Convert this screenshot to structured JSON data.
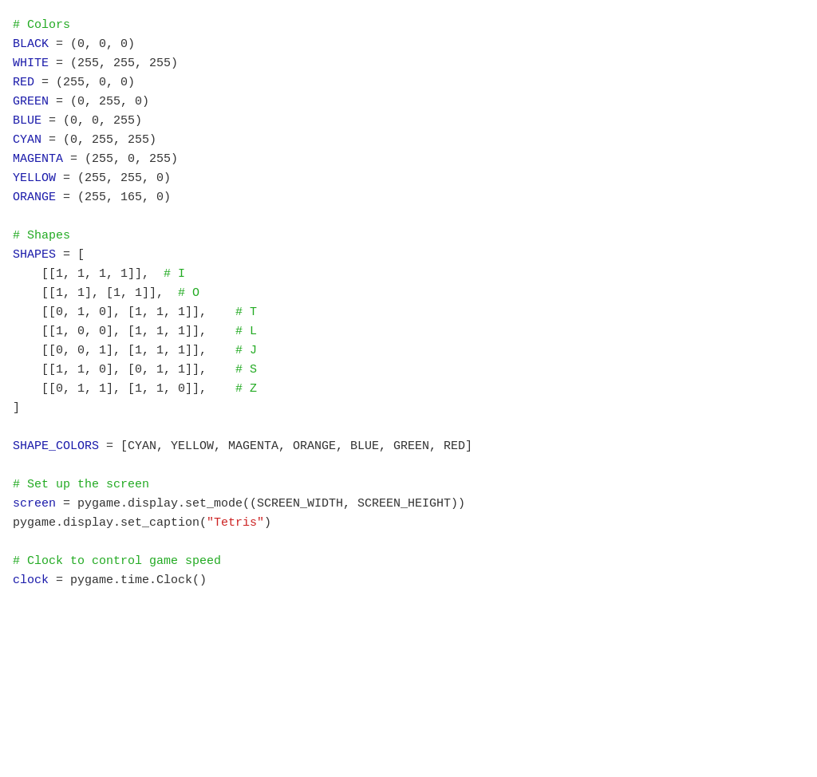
{
  "code": {
    "sections": [
      {
        "id": "colors-comment",
        "type": "comment",
        "text": "# Colors"
      },
      {
        "id": "black",
        "parts": [
          {
            "type": "variable",
            "text": "BLACK"
          },
          {
            "type": "plain",
            "text": " = (0, 0, 0)"
          }
        ]
      },
      {
        "id": "white",
        "parts": [
          {
            "type": "variable",
            "text": "WHITE"
          },
          {
            "type": "plain",
            "text": " = (255, 255, 255)"
          }
        ]
      },
      {
        "id": "red",
        "parts": [
          {
            "type": "variable",
            "text": "RED"
          },
          {
            "type": "plain",
            "text": " = (255, 0, 0)"
          }
        ]
      },
      {
        "id": "green",
        "parts": [
          {
            "type": "variable",
            "text": "GREEN"
          },
          {
            "type": "plain",
            "text": " = (0, 255, 0)"
          }
        ]
      },
      {
        "id": "blue",
        "parts": [
          {
            "type": "variable",
            "text": "BLUE"
          },
          {
            "type": "plain",
            "text": " = (0, 0, 255)"
          }
        ]
      },
      {
        "id": "cyan",
        "parts": [
          {
            "type": "variable",
            "text": "CYAN"
          },
          {
            "type": "plain",
            "text": " = (0, 255, 255)"
          }
        ]
      },
      {
        "id": "magenta",
        "parts": [
          {
            "type": "variable",
            "text": "MAGENTA"
          },
          {
            "type": "plain",
            "text": " = (255, 0, 255)"
          }
        ]
      },
      {
        "id": "yellow",
        "parts": [
          {
            "type": "variable",
            "text": "YELLOW"
          },
          {
            "type": "plain",
            "text": " = (255, 255, 0)"
          }
        ]
      },
      {
        "id": "orange",
        "parts": [
          {
            "type": "variable",
            "text": "ORANGE"
          },
          {
            "type": "plain",
            "text": " = (255, 165, 0)"
          }
        ]
      },
      {
        "id": "blank1",
        "parts": [
          {
            "type": "plain",
            "text": ""
          }
        ]
      },
      {
        "id": "shapes-comment",
        "type": "comment",
        "text": "# Shapes"
      },
      {
        "id": "shapes-open",
        "parts": [
          {
            "type": "variable",
            "text": "SHAPES"
          },
          {
            "type": "plain",
            "text": " = ["
          }
        ]
      },
      {
        "id": "shape-i",
        "parts": [
          {
            "type": "plain",
            "text": "    [[1, 1, 1, 1]],  "
          },
          {
            "type": "comment",
            "text": "# I"
          }
        ]
      },
      {
        "id": "shape-o",
        "parts": [
          {
            "type": "plain",
            "text": "    [[1, 1], [1, 1]],  "
          },
          {
            "type": "comment",
            "text": "# O"
          }
        ]
      },
      {
        "id": "shape-t",
        "parts": [
          {
            "type": "plain",
            "text": "    [[0, 1, 0], [1, 1, 1]],  "
          },
          {
            "type": "comment",
            "text": "  # T"
          }
        ]
      },
      {
        "id": "shape-l",
        "parts": [
          {
            "type": "plain",
            "text": "    [[1, 0, 0], [1, 1, 1]],  "
          },
          {
            "type": "comment",
            "text": "  # L"
          }
        ]
      },
      {
        "id": "shape-j",
        "parts": [
          {
            "type": "plain",
            "text": "    [[0, 0, 1], [1, 1, 1]],  "
          },
          {
            "type": "comment",
            "text": "  # J"
          }
        ]
      },
      {
        "id": "shape-s",
        "parts": [
          {
            "type": "plain",
            "text": "    [[1, 1, 0], [0, 1, 1]],  "
          },
          {
            "type": "comment",
            "text": "  # S"
          }
        ]
      },
      {
        "id": "shape-z",
        "parts": [
          {
            "type": "plain",
            "text": "    [[0, 1, 1], [1, 1, 0]],  "
          },
          {
            "type": "comment",
            "text": "  # Z"
          }
        ]
      },
      {
        "id": "shapes-close",
        "parts": [
          {
            "type": "plain",
            "text": "]"
          }
        ]
      },
      {
        "id": "blank2",
        "parts": [
          {
            "type": "plain",
            "text": ""
          }
        ]
      },
      {
        "id": "shape-colors",
        "parts": [
          {
            "type": "variable",
            "text": "SHAPE_COLORS"
          },
          {
            "type": "plain",
            "text": " = [CYAN, YELLOW, MAGENTA, ORANGE, BLUE, GREEN, RED]"
          }
        ]
      },
      {
        "id": "blank3",
        "parts": [
          {
            "type": "plain",
            "text": ""
          }
        ]
      },
      {
        "id": "screen-comment",
        "type": "comment",
        "text": "# Set up the screen"
      },
      {
        "id": "screen-setup",
        "parts": [
          {
            "type": "variable",
            "text": "screen"
          },
          {
            "type": "plain",
            "text": " = pygame.display.set_mode((SCREEN_WIDTH, SCREEN_HEIGHT))"
          }
        ]
      },
      {
        "id": "caption",
        "parts": [
          {
            "type": "plain",
            "text": "pygame.display.set_caption("
          },
          {
            "type": "string",
            "text": "\"Tetris\""
          },
          {
            "type": "plain",
            "text": ")"
          }
        ]
      },
      {
        "id": "blank4",
        "parts": [
          {
            "type": "plain",
            "text": ""
          }
        ]
      },
      {
        "id": "clock-comment",
        "type": "comment",
        "text": "# Clock to control game speed"
      },
      {
        "id": "clock-setup",
        "parts": [
          {
            "type": "variable",
            "text": "clock"
          },
          {
            "type": "plain",
            "text": " = pygame.time.Clock()"
          }
        ]
      }
    ]
  }
}
